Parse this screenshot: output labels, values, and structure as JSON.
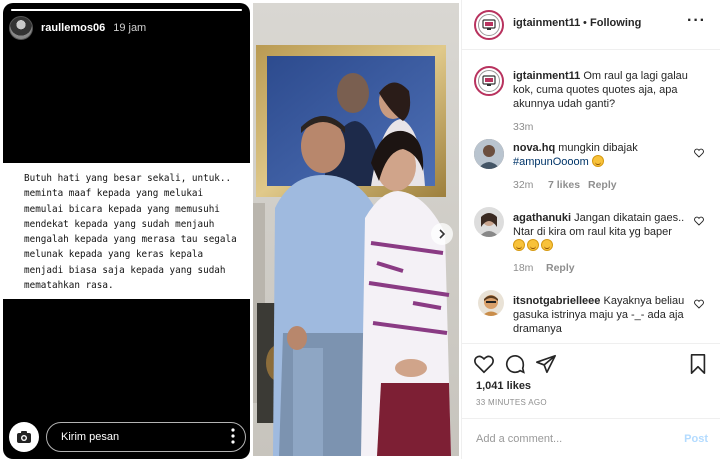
{
  "story": {
    "username": "raullemos06",
    "time": "19 jam",
    "quote_lines": [
      "Butuh hati yang besar sekali, untuk..",
      "meminta maaf kepada yang melukai",
      "memulai bicara kepada yang memusuhi",
      "mendekat kepada yang sudah menjauh",
      "mengalah kepada yang merasa tau segala",
      "melunak kepada yang keras kepala",
      "menjadi biasa saja kepada yang sudah",
      "mematahkan rasa."
    ],
    "reply_placeholder": "Kirim pesan",
    "progress": 1.0
  },
  "post": {
    "username": "igtainment11",
    "separator": "•",
    "follow_status": "Following",
    "more": "···",
    "caption": {
      "username": "igtainment11",
      "text": "Om raul ga lagi galau kok, cuma quotes quotes aja, apa akunnya udah ganti?",
      "time": "33m"
    },
    "comments": [
      {
        "username": "nova.hq",
        "text": "mungkin dibajak",
        "hashtag": "#ampunOooom",
        "time": "32m",
        "likes": "7 likes",
        "reply": "Reply"
      },
      {
        "username": "agathanuki",
        "text": "Jangan dikatain gaes.. Ntar di kira om raul kita yg baper",
        "time": "18m",
        "reply": "Reply"
      },
      {
        "username": "itsnotgabrielleee",
        "text": "Kayaknya beliau gasuka istrinya maju ya -_- ada aja dramanya"
      }
    ],
    "likes": "1,041 likes",
    "posted_ago": "33 MINUTES AGO",
    "add_comment_placeholder": "Add a comment...",
    "post_button": "Post"
  },
  "icons": {
    "camera": "camera-icon",
    "more_vertical": "more-vertical-icon",
    "heart": "heart-icon",
    "comment": "comment-icon",
    "share": "share-icon",
    "bookmark": "bookmark-icon",
    "next": "chevron-right-icon"
  },
  "colors": {
    "link": "#003569",
    "muted": "#8e8e8e",
    "post_button_disabled": "#b3dbff",
    "brand_ring": "#b8325e"
  }
}
